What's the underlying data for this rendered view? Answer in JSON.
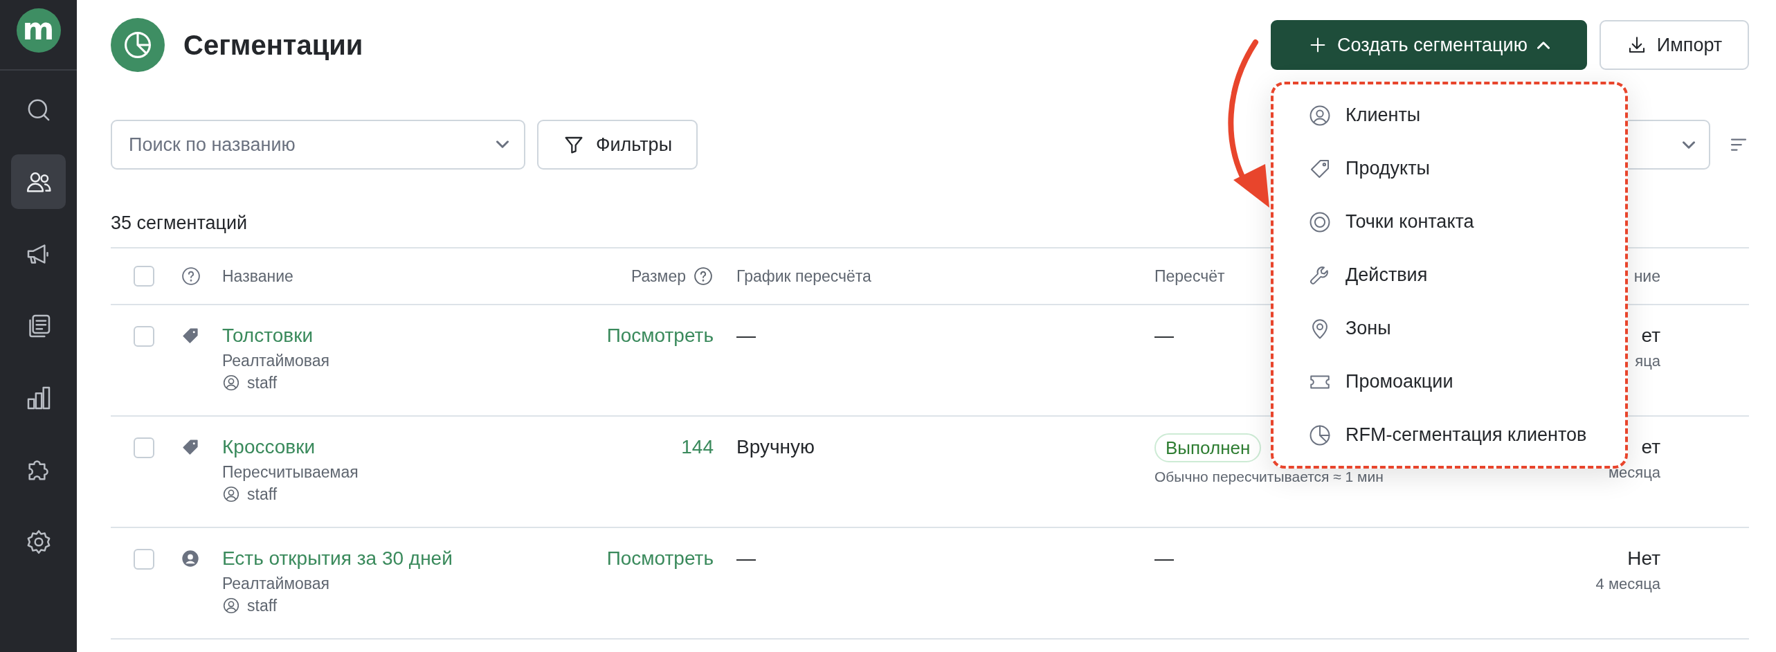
{
  "sidebar": {
    "logo": "m",
    "items": [
      {
        "selected": false
      },
      {
        "selected": true
      },
      {
        "selected": false
      },
      {
        "selected": false
      },
      {
        "selected": false
      },
      {
        "selected": false
      },
      {
        "selected": false
      }
    ]
  },
  "header": {
    "title": "Сегментации",
    "create_button": "Создать сегментацию",
    "import_button": "Импорт"
  },
  "toolbar": {
    "search": {
      "placeholder": "Поиск по названию"
    },
    "filters_button": "Фильтры"
  },
  "count": "35 сегментаций",
  "table": {
    "select_all": {
      "checked": false
    },
    "columns": [
      {
        "label": "Название",
        "help": false
      },
      {
        "label": "Размер",
        "help": true
      },
      {
        "label": "График пересчёта",
        "help": false
      },
      {
        "label": "Пересчёт",
        "help": false
      },
      {
        "label": "ние",
        "help": false
      }
    ],
    "rows": [
      {
        "checked": false,
        "kind": "product",
        "name": "Толстовки",
        "type": "Реалтаймовая",
        "owner": "staff",
        "size": "Посмотреть",
        "schedule": "—",
        "recalc": "—",
        "changed": "ет",
        "changed_sub": "яца"
      },
      {
        "checked": false,
        "kind": "product",
        "name": "Кроссовки",
        "type": "Пересчитываемая",
        "owner": "staff",
        "size": "144",
        "schedule": "Вручную",
        "status": "Выполнен",
        "status_note": "Обычно пересчитывается ≈ 1 мин",
        "changed": "ет",
        "changed_sub": "месяца"
      },
      {
        "checked": false,
        "kind": "client",
        "name": "Есть открытия за 30 дней",
        "type": "Реалтаймовая",
        "owner": "staff",
        "size": "Посмотреть",
        "schedule": "—",
        "recalc": "—",
        "changed": "Нет",
        "changed_sub": "4 месяца"
      }
    ]
  },
  "create_menu": {
    "items": [
      {
        "label": "Клиенты"
      },
      {
        "label": "Продукты"
      },
      {
        "label": "Точки контакта"
      },
      {
        "label": "Действия"
      },
      {
        "label": "Зоны"
      },
      {
        "label": "Промоакции"
      },
      {
        "label": "RFM-сегментация клиентов"
      }
    ]
  }
}
